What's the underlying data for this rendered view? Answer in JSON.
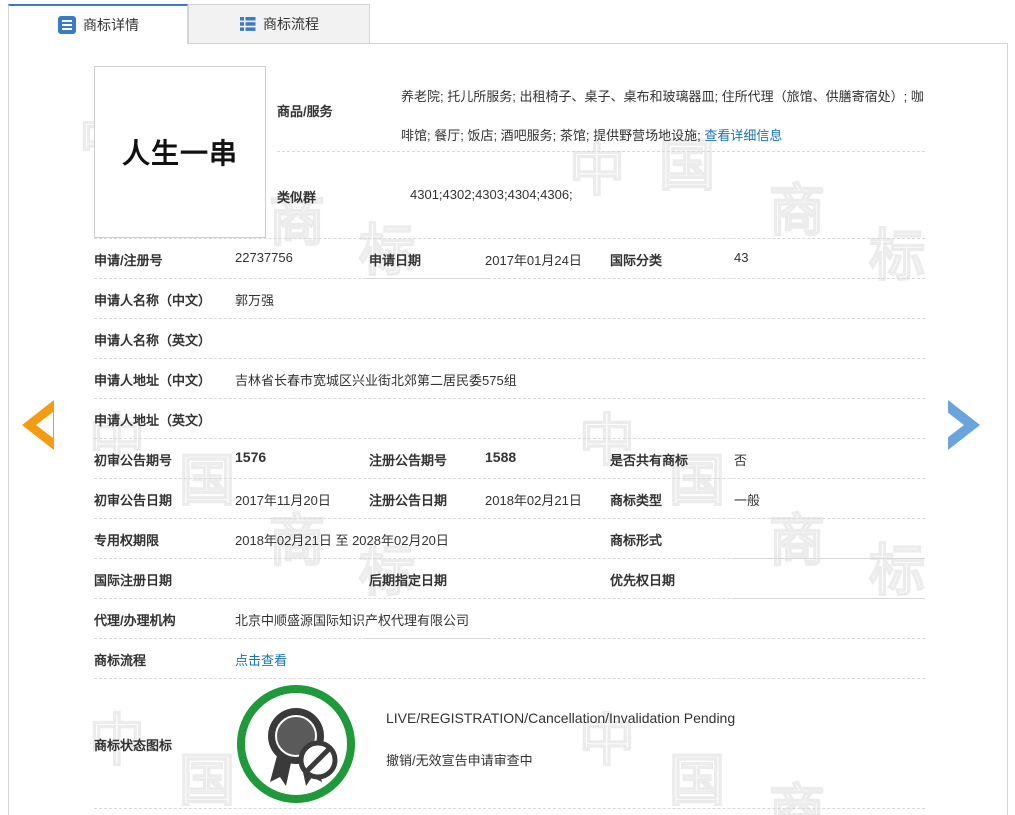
{
  "tabs": [
    {
      "label": "商标详情",
      "icon": "list-icon",
      "active": true
    },
    {
      "label": "商标流程",
      "icon": "grid-list-icon",
      "active": false
    }
  ],
  "logo": {
    "text": "人生一串"
  },
  "goods": {
    "label": "商品/服务",
    "text": "养老院; 托儿所服务; 出租椅子、桌子、桌布和玻璃器皿; 住所代理（旅馆、供膳寄宿处）; 咖啡馆; 餐厅; 饭店; 酒吧服务; 茶馆; 提供野营场地设施;",
    "link": "查看详细信息"
  },
  "similar_group": {
    "label": "类似群",
    "value": "4301;4302;4303;4304;4306;"
  },
  "fields": {
    "reg_no": {
      "label": "申请/注册号",
      "value": "22737756"
    },
    "app_date": {
      "label": "申请日期",
      "value": "2017年01月24日"
    },
    "intl_class": {
      "label": "国际分类",
      "value": "43"
    },
    "applicant_cn": {
      "label": "申请人名称（中文）",
      "value": "郭万强"
    },
    "applicant_en": {
      "label": "申请人名称（英文）",
      "value": ""
    },
    "address_cn": {
      "label": "申请人地址（中文）",
      "value": "吉林省长春市宽城区兴业街北郊第二居民委575组"
    },
    "address_en": {
      "label": "申请人地址（英文）",
      "value": ""
    },
    "prelim_no": {
      "label": "初审公告期号",
      "value": "1576"
    },
    "reg_pub_no": {
      "label": "注册公告期号",
      "value": "1588"
    },
    "shared": {
      "label": "是否共有商标",
      "value": "否"
    },
    "prelim_date": {
      "label": "初审公告日期",
      "value": "2017年11月20日"
    },
    "reg_pub_date": {
      "label": "注册公告日期",
      "value": "2018年02月21日"
    },
    "tm_type": {
      "label": "商标类型",
      "value": "一般"
    },
    "exclusive": {
      "label": "专用权期限",
      "value": "2018年02月21日 至 2028年02月20日"
    },
    "tm_form": {
      "label": "商标形式",
      "value": ""
    },
    "intl_reg_date": {
      "label": "国际注册日期",
      "value": ""
    },
    "later_date": {
      "label": "后期指定日期",
      "value": ""
    },
    "priority_date": {
      "label": "优先权日期",
      "value": ""
    },
    "agent": {
      "label": "代理/办理机构",
      "value": "北京中顺盛源国际知识产权代理有限公司"
    },
    "flow": {
      "label": "商标流程",
      "link": "点击查看"
    },
    "status": {
      "label": "商标状态图标",
      "en": "LIVE/REGISTRATION/Cancellation/Invalidation Pending",
      "cn": "撤销/无效宣告申请审查中"
    }
  },
  "colors": {
    "accent": "#3a7bc8",
    "link": "#1a73b8",
    "prev_arrow": "#f39c12",
    "next_arrow": "#6aa4dc",
    "status_ring": "#1e9a3a"
  }
}
